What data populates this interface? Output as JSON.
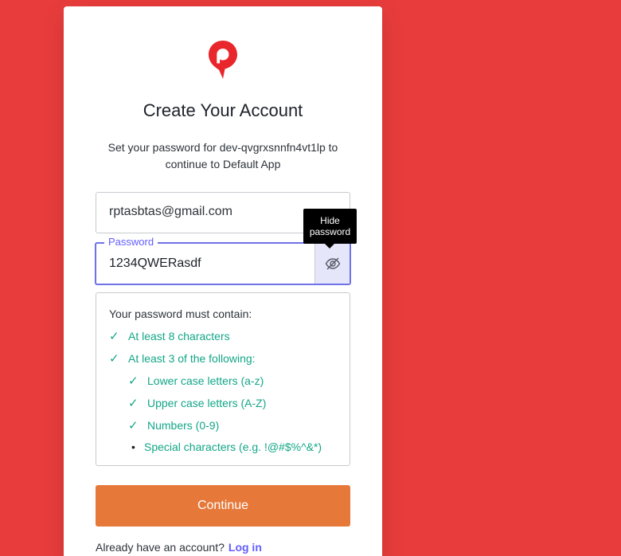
{
  "colors": {
    "background": "#e83c3c",
    "accent": "#635dff",
    "success": "#13a688",
    "button": "#e6793a"
  },
  "logo": {
    "icon": "location-pin-logo"
  },
  "title": "Create Your Account",
  "subtitle": "Set your password for dev-qvgrxsnnfn4vt1lp to continue to Default App",
  "email": {
    "value": "rptasbtas@gmail.com"
  },
  "password": {
    "label": "Password",
    "value": "1234QWERasdf",
    "toggle_icon": "eye-slash-icon"
  },
  "tooltip": {
    "line1": "Hide",
    "line2": "password"
  },
  "rules": {
    "heading": "Your password must contain:",
    "items": [
      {
        "mark": "✓",
        "text": "At least 8 characters"
      },
      {
        "mark": "✓",
        "text": "At least 3 of the following:"
      },
      {
        "mark": "✓",
        "text": "Lower case letters (a-z)"
      },
      {
        "mark": "✓",
        "text": "Upper case letters (A-Z)"
      },
      {
        "mark": "✓",
        "text": "Numbers (0-9)"
      },
      {
        "mark": "•",
        "text": "Special characters (e.g. !@#$%^&*)"
      }
    ]
  },
  "continue_label": "Continue",
  "footer": {
    "text": "Already have an account?",
    "link": "Log in"
  }
}
